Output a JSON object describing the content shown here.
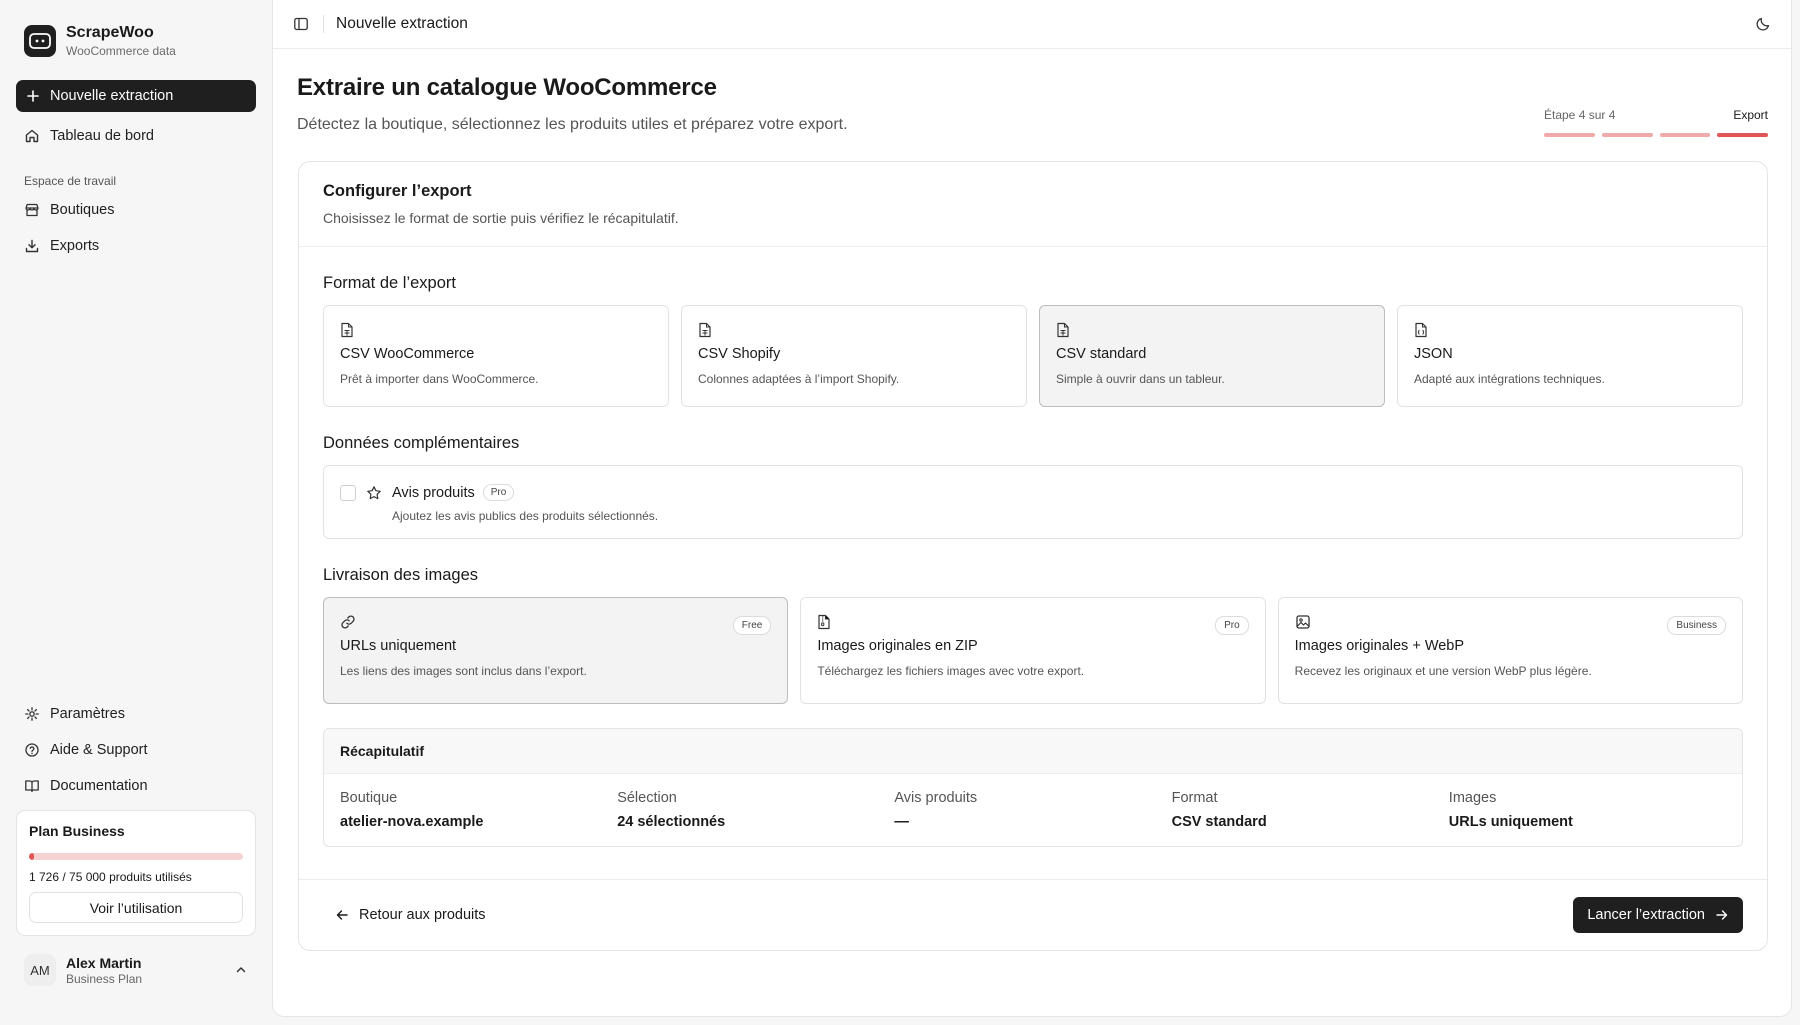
{
  "brand": {
    "name": "ScrapeWoo",
    "subtitle": "WooCommerce data",
    "icon": "bot-icon"
  },
  "sidebar": {
    "new_extraction": "Nouvelle extraction",
    "dashboard": "Tableau de bord",
    "workspace_label": "Espace de travail",
    "workspace_items": [
      {
        "label": "Boutiques",
        "icon": "store-icon"
      },
      {
        "label": "Exports",
        "icon": "download-icon"
      }
    ],
    "bottom_items": [
      {
        "label": "Paramètres",
        "icon": "gear-icon"
      },
      {
        "label": "Aide & Support",
        "icon": "help-icon"
      },
      {
        "label": "Documentation",
        "icon": "book-icon"
      }
    ],
    "plan": {
      "title": "Plan Business",
      "usage": "1 726 / 75 000 produits utilisés",
      "used": 1726,
      "total": 75000,
      "button": "Voir l’utilisation"
    },
    "user": {
      "initials": "AM",
      "name": "Alex Martin",
      "plan": "Business Plan"
    }
  },
  "topbar": {
    "title": "Nouvelle extraction"
  },
  "page": {
    "title": "Extraire un catalogue WooCommerce",
    "subtitle": "Détectez la boutique, sélectionnez les produits utiles et préparez votre export.",
    "stepper": {
      "step_text": "Étape 4 sur 4",
      "current": "Export",
      "total_steps": 4,
      "current_step": 4
    }
  },
  "card": {
    "title": "Configurer l’export",
    "subtitle": "Choisissez le format de sortie puis vérifiez le récapitulatif.",
    "format_title": "Format de l’export",
    "formats": [
      {
        "title": "CSV WooCommerce",
        "desc": "Prêt à importer dans WooCommerce.",
        "selected": false
      },
      {
        "title": "CSV Shopify",
        "desc": "Colonnes adaptées à l’import Shopify.",
        "selected": false
      },
      {
        "title": "CSV standard",
        "desc": "Simple à ouvrir dans un tableur.",
        "selected": true
      },
      {
        "title": "JSON",
        "desc": "Adapté aux intégrations techniques.",
        "selected": false
      }
    ],
    "extra_title": "Données complémentaires",
    "extra": {
      "title": "Avis produits",
      "tag": "Pro",
      "desc": "Ajoutez les avis publics des produits sélectionnés.",
      "checked": false
    },
    "images_title": "Livraison des images",
    "images": [
      {
        "title": "URLs uniquement",
        "desc": "Les liens des images sont inclus dans l’export.",
        "badge": "Free",
        "icon": "link-icon",
        "selected": true
      },
      {
        "title": "Images originales en ZIP",
        "desc": "Téléchargez les fichiers images avec votre export.",
        "badge": "Pro",
        "icon": "file-archive-icon",
        "selected": false
      },
      {
        "title": "Images originales + WebP",
        "desc": "Recevez les originaux et une version WebP plus légère.",
        "badge": "Business",
        "icon": "image-icon",
        "selected": false
      }
    ],
    "summary": {
      "title": "Récapitulatif",
      "items": [
        {
          "label": "Boutique",
          "value": "atelier-nova.example"
        },
        {
          "label": "Sélection",
          "value": "24 sélectionnés"
        },
        {
          "label": "Avis produits",
          "value": "—"
        },
        {
          "label": "Format",
          "value": "CSV standard"
        },
        {
          "label": "Images",
          "value": "URLs uniquement"
        }
      ]
    },
    "back_button": "Retour aux produits",
    "launch_button": "Lancer l’extraction"
  }
}
